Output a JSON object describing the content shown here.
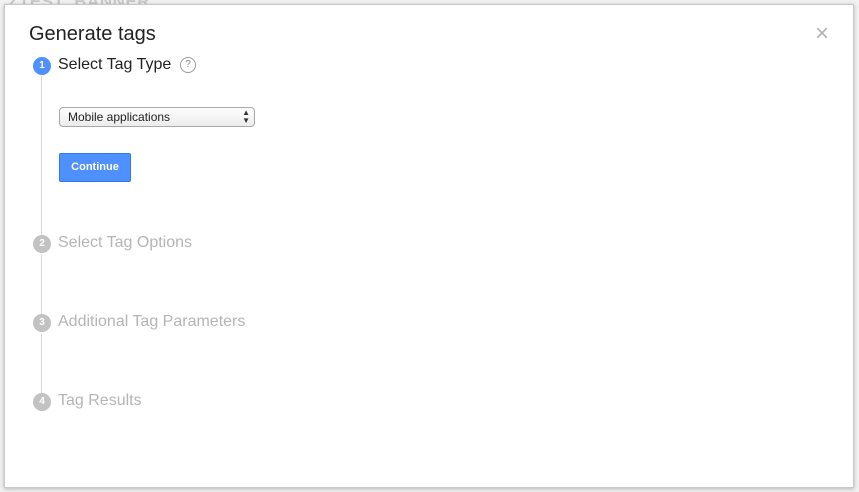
{
  "background": {
    "banner_text": "ZTEST_BANNER"
  },
  "dialog": {
    "title": "Generate tags",
    "close_glyph": "×"
  },
  "steps": [
    {
      "number": "1",
      "label": "Select Tag Type",
      "state": "active"
    },
    {
      "number": "2",
      "label": "Select Tag Options",
      "state": "inactive"
    },
    {
      "number": "3",
      "label": "Additional Tag Parameters",
      "state": "inactive"
    },
    {
      "number": "4",
      "label": "Tag Results",
      "state": "inactive"
    }
  ],
  "help_glyph": "?",
  "tag_type_select": {
    "value": "Mobile applications"
  },
  "continue_label": "Continue",
  "colors": {
    "accent": "#4d90fe",
    "inactive": "#c2c2c2"
  }
}
